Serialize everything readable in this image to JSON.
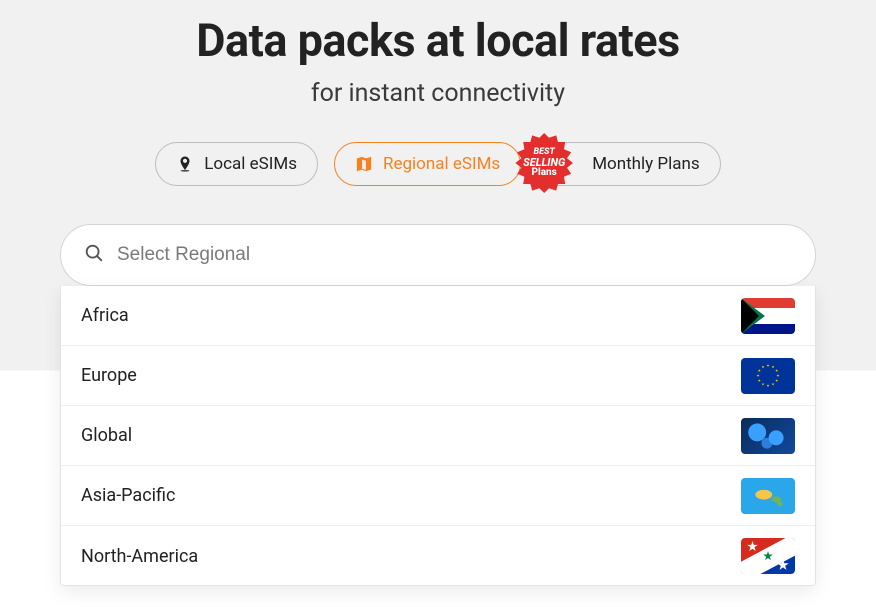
{
  "heading": {
    "title": "Data packs at local rates",
    "subtitle": "for instant connectivity"
  },
  "tabs": {
    "local": "Local eSIMs",
    "regional": "Regional eSIMs",
    "monthly": "Monthly Plans"
  },
  "badge": {
    "line1": "BEST",
    "line2": "SELLING",
    "line3": "Plans"
  },
  "search": {
    "placeholder": "Select Regional"
  },
  "regions": [
    {
      "label": "Africa",
      "flag": "za"
    },
    {
      "label": "Europe",
      "flag": "eu"
    },
    {
      "label": "Global",
      "flag": "global"
    },
    {
      "label": "Asia-Pacific",
      "flag": "apac"
    },
    {
      "label": "North-America",
      "flag": "na"
    }
  ]
}
